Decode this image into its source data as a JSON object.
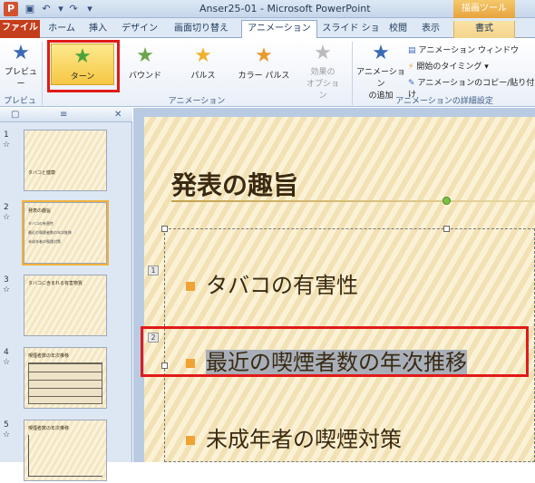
{
  "window": {
    "title": "Anser25-01 - Microsoft PowerPoint",
    "app_icon": "P",
    "context_tool": "描画ツール"
  },
  "tabs": [
    {
      "label": "ファイル"
    },
    {
      "label": "ホーム"
    },
    {
      "label": "挿入"
    },
    {
      "label": "デザイン"
    },
    {
      "label": "画面切り替え"
    },
    {
      "label": "アニメーション"
    },
    {
      "label": "スライド ショー"
    },
    {
      "label": "校閲"
    },
    {
      "label": "表示"
    },
    {
      "label": "書式"
    }
  ],
  "ribbon": {
    "preview_group": {
      "button": "プレビュー",
      "label": "プレビュー"
    },
    "animation_group": {
      "items": [
        {
          "label": "ターン",
          "icon": "star-turn-icon"
        },
        {
          "label": "バウンド",
          "icon": "star-bounce-icon"
        },
        {
          "label": "パルス",
          "icon": "star-pulse-icon"
        },
        {
          "label": "カラー パルス",
          "icon": "star-color-pulse-icon"
        }
      ],
      "effect_options": "効果の\nオプション",
      "label": "アニメーション"
    },
    "advanced_group": {
      "add_animation": "アニメーション\nの追加",
      "animation_window": "アニメーション ウィンドウ",
      "start_timing": "開始のタイミング",
      "copy_animation": "アニメーションのコピー/貼り付け",
      "label": "アニメーションの詳細設定"
    }
  },
  "slides_pane": {
    "thumbs": [
      {
        "num": "1",
        "star": "☆",
        "title": "タバコと健康"
      },
      {
        "num": "2",
        "star": "☆",
        "title": "発表の趣旨"
      },
      {
        "num": "3",
        "star": "☆",
        "title": "タバコに含まれる有害物質"
      },
      {
        "num": "4",
        "star": "☆",
        "title": "喫煙者数の年次推移"
      },
      {
        "num": "5",
        "star": "☆",
        "title": "喫煙者数の年次推移"
      }
    ]
  },
  "slide": {
    "title": "発表の趣旨",
    "bullets": [
      {
        "text": "タバコの有害性",
        "tag": "1"
      },
      {
        "text": "最近の喫煙者数の年次推移",
        "tag": "2"
      },
      {
        "text": "未成年者の喫煙対策",
        "tag": ""
      }
    ]
  }
}
